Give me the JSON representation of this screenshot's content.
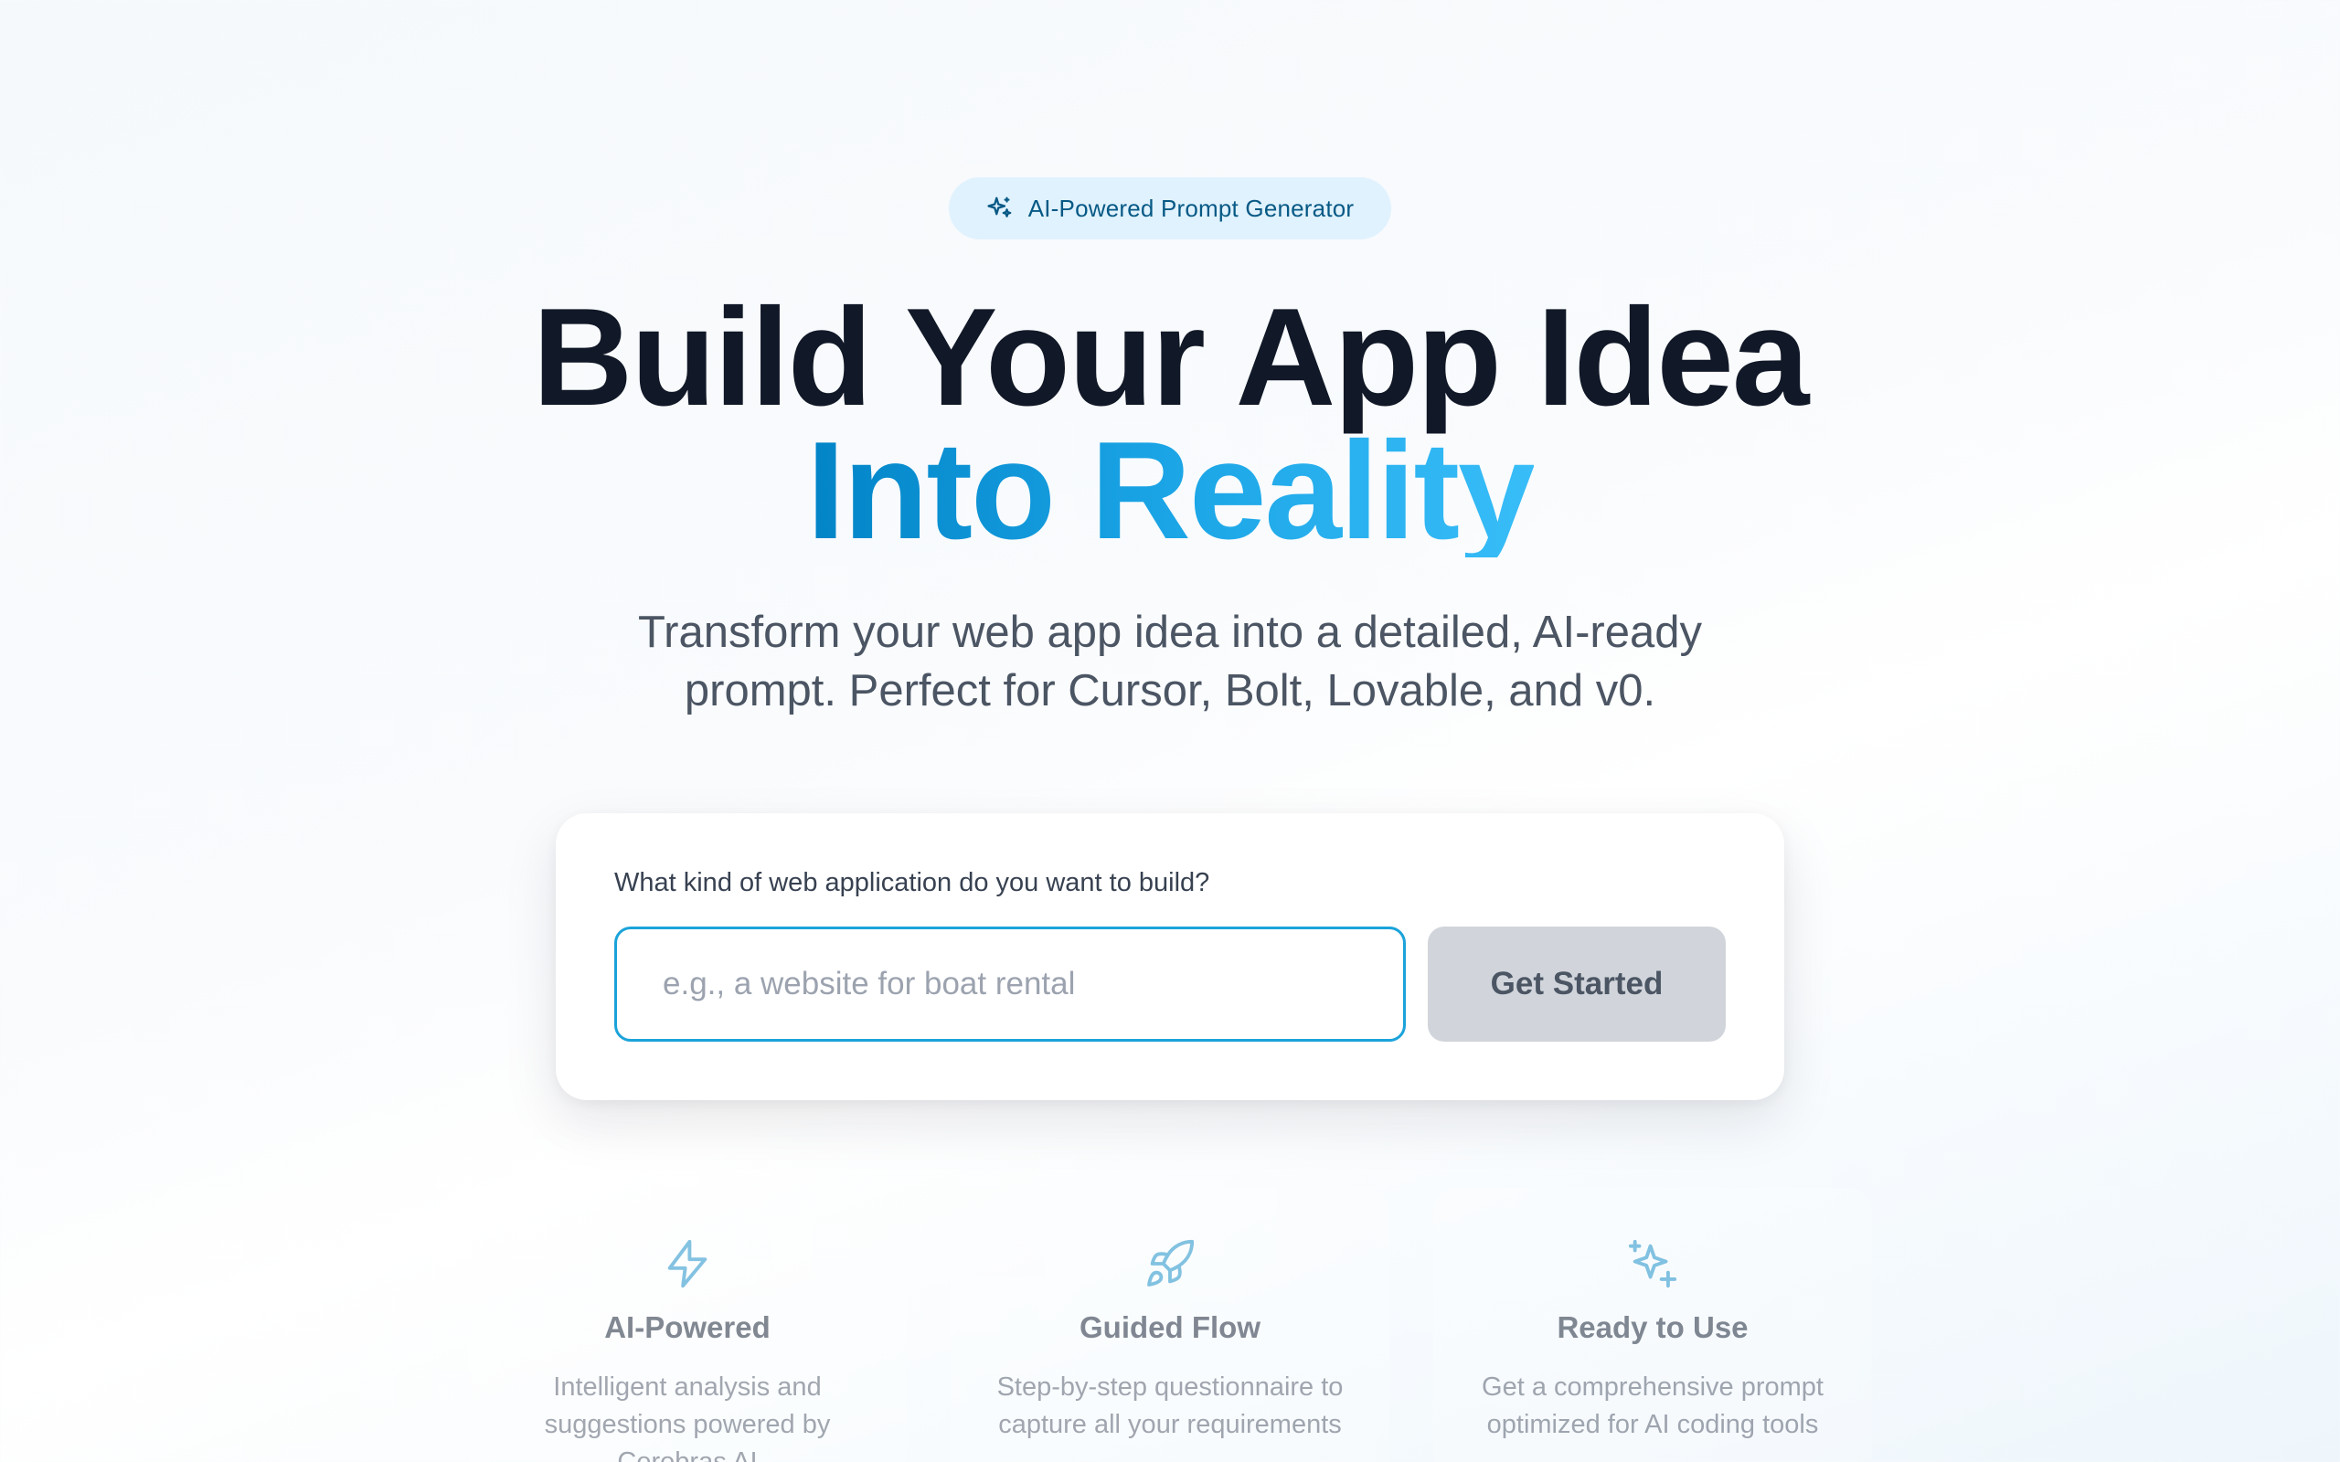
{
  "badge": {
    "icon": "sparkle-icon",
    "label": "AI-Powered Prompt Generator"
  },
  "hero": {
    "title_line1": "Build Your App Idea",
    "title_line2": "Into Reality"
  },
  "subtitle": {
    "line1": "Transform your web app idea into a detailed, AI-ready",
    "line2": "prompt. Perfect for Cursor, Bolt, Lovable, and v0."
  },
  "form": {
    "label": "What kind of web application do you want to build?",
    "placeholder": "e.g., a website for boat rental",
    "value": "",
    "button_label": "Get Started"
  },
  "features": [
    {
      "icon": "lightning-icon",
      "title": "AI-Powered",
      "description": "Intelligent analysis and suggestions powered by Cerebras AI"
    },
    {
      "icon": "rocket-icon",
      "title": "Guided Flow",
      "description": "Step-by-step questionnaire to capture all your requirements"
    },
    {
      "icon": "sparkles-icon",
      "title": "Ready to Use",
      "description": "Get a comprehensive prompt optimized for AI coding tools"
    }
  ],
  "colors": {
    "accent": "#0ea5e9",
    "accent_dark": "#0284c7",
    "badge_bg": "#e0f2fe",
    "button_disabled": "#d1d5db",
    "icon_tint": "#5ab4dc"
  }
}
